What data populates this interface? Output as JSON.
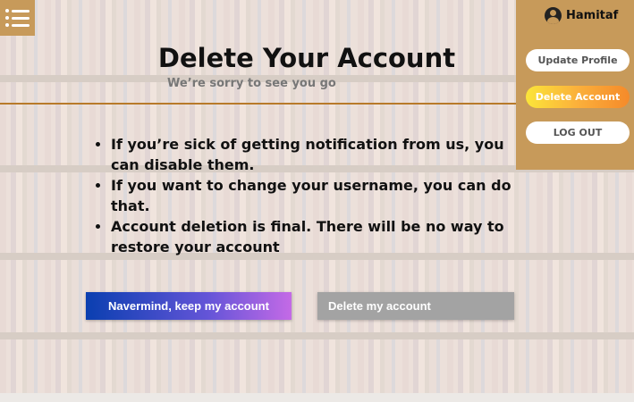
{
  "menu": {
    "icon": "list-menu-icon"
  },
  "header": {
    "title": "Delete Your Account",
    "subtitle": "We’re sorry to see you go"
  },
  "bullets": [
    "If you’re sick of getting notification from us, you can disable them.",
    "If you want to change your username, you can do that.",
    "Account deletion is final. There will be no way to restore your account"
  ],
  "actions": {
    "keep_label": "Navermind, keep my account",
    "delete_label": "Delete my account"
  },
  "side_panel": {
    "username": "Hamitaf",
    "avatar_icon": "user-avatar-icon",
    "update_label": "Update Profile",
    "delete_label": "Delete Account",
    "logout_label": "LOG OUT"
  },
  "colors": {
    "accent": "#c79a5a",
    "rule": "#b87a2a",
    "keep_gradient": [
      "#0a3fb0",
      "#c46ae6"
    ],
    "delete_gradient": [
      "#fbe53a",
      "#f58a2a"
    ],
    "disabled": "#a3a3a3"
  }
}
